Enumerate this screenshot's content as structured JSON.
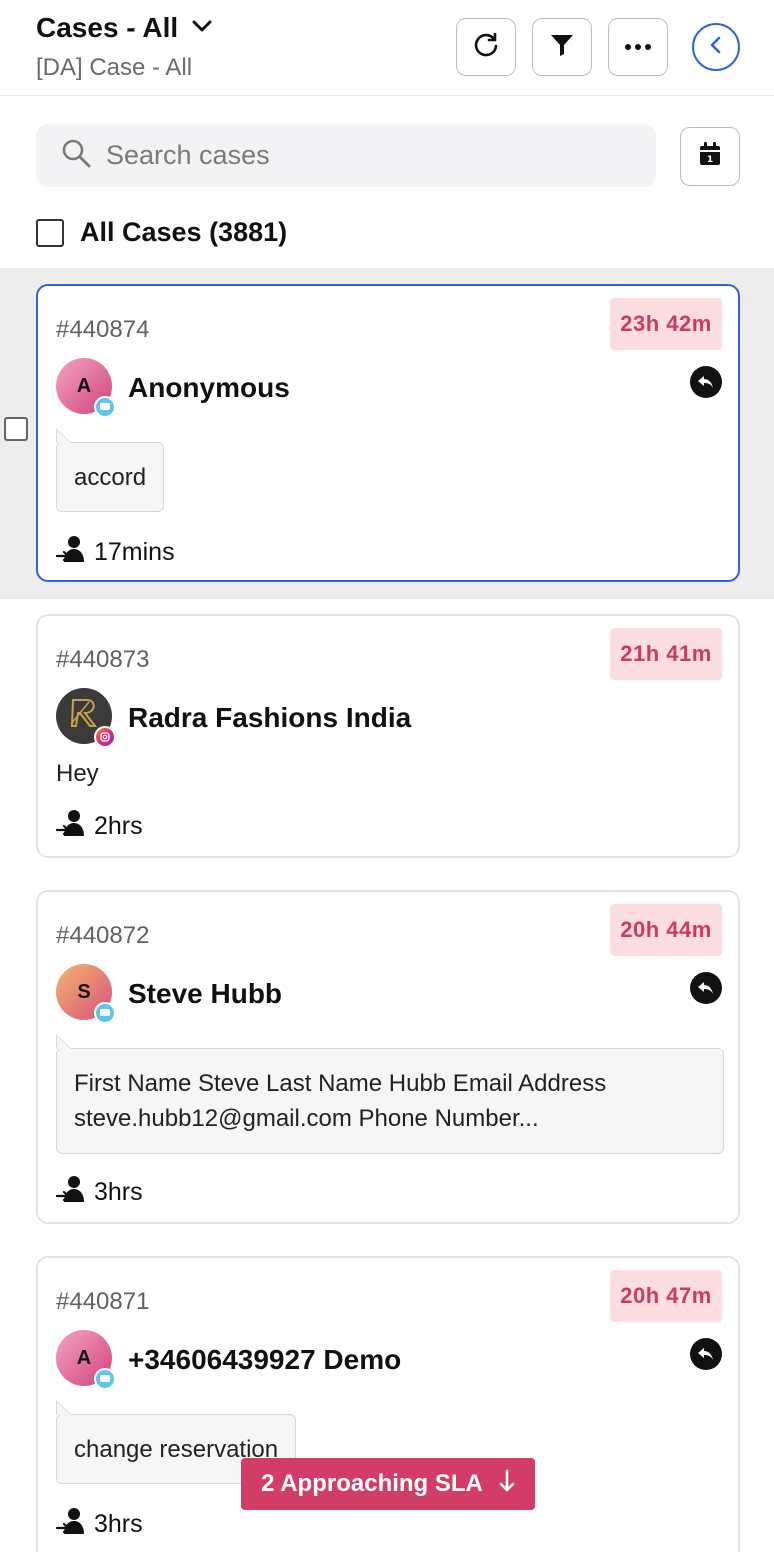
{
  "header": {
    "title": "Cases - All",
    "subtitle": "[DA] Case - All",
    "buttons": {
      "refresh_icon": "refresh-icon",
      "filter_icon": "filter-icon",
      "more_icon": "more-icon",
      "collapse_icon": "chevron-left-icon"
    },
    "accent_color": "#2f63d9"
  },
  "search": {
    "placeholder": "Search cases",
    "value": ""
  },
  "all_cases": {
    "label": "All Cases (3881)"
  },
  "cases": [
    {
      "id": "#440874",
      "sla": "23h 42m",
      "avatar_letter": "A",
      "channel": "chat",
      "name": "Anonymous",
      "message": "accord",
      "message_style": "bubble",
      "time": "17mins",
      "has_reply": true,
      "selected": true
    },
    {
      "id": "#440873",
      "sla": "21h 41m",
      "avatar_letter": "",
      "channel": "instagram",
      "name": "Radra Fashions India",
      "message": "Hey",
      "message_style": "plain",
      "time": "2hrs",
      "has_reply": false,
      "selected": false
    },
    {
      "id": "#440872",
      "sla": "20h 44m",
      "avatar_letter": "S",
      "channel": "chat",
      "name": "Steve Hubb",
      "message_line1": "First Name Steve Last Name Hubb Email Address",
      "message_line2": "steve.hubb12@gmail.com Phone Number...",
      "message_style": "bubble",
      "time": "3hrs",
      "has_reply": true,
      "selected": false
    },
    {
      "id": "#440871",
      "sla": "20h 47m",
      "avatar_letter": "A",
      "channel": "chat",
      "name": "+34606439927 Demo",
      "message": "change reservation",
      "message_style": "bubble",
      "time": "3hrs",
      "has_reply": true,
      "selected": false
    }
  ],
  "toast": {
    "label": "2 Approaching SLA",
    "color": "#d23d68"
  },
  "colors": {
    "sla_bg": "#fbdde2",
    "sla_text": "#cc3a62"
  }
}
